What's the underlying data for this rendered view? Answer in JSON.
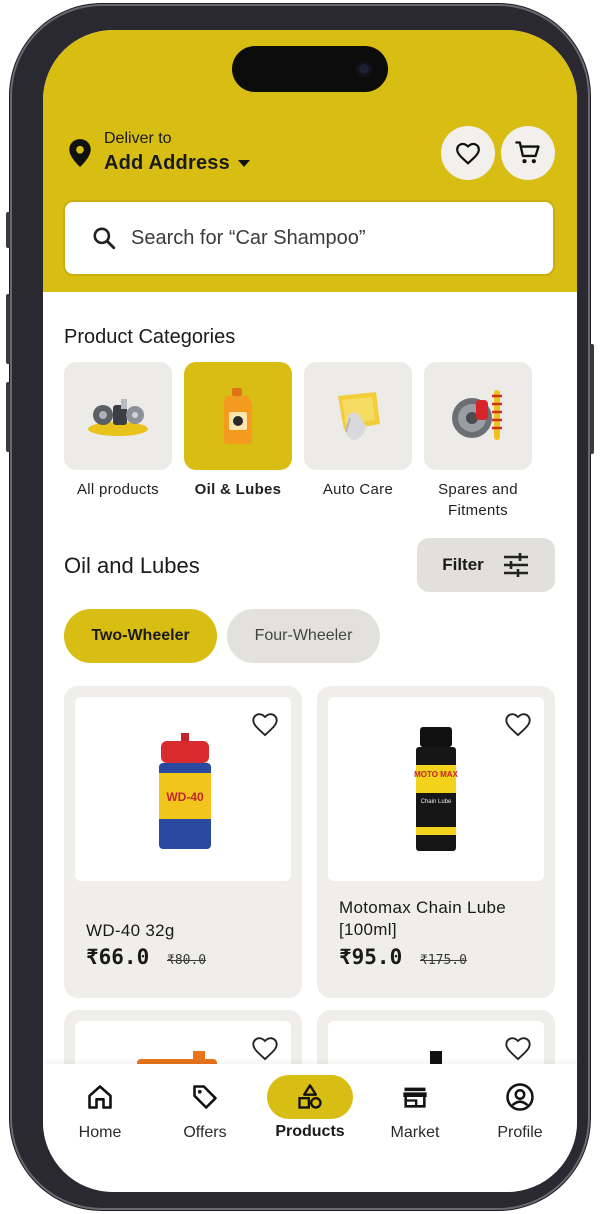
{
  "header": {
    "deliver_label": "Deliver to",
    "address": "Add Address"
  },
  "search": {
    "placeholder": "Search for “Car Shampoo”"
  },
  "categories": {
    "title": "Product Categories",
    "items": [
      {
        "label": "All products",
        "active": false
      },
      {
        "label": "Oil & Lubes",
        "active": true
      },
      {
        "label": "Auto Care",
        "active": false
      },
      {
        "label": "Spares and Fitments",
        "active": false
      }
    ]
  },
  "listing": {
    "title": "Oil and Lubes",
    "filter_label": "Filter",
    "pills": [
      {
        "label": "Two-Wheeler",
        "active": true
      },
      {
        "label": "Four-Wheeler",
        "active": false
      }
    ]
  },
  "products": [
    {
      "name": "WD-40 32g",
      "price": "₹66.0",
      "old_price": "₹80.0",
      "label_text": "WD-40"
    },
    {
      "name": "Motomax Chain Lube [100ml]",
      "price": "₹95.0",
      "old_price": "₹175.0",
      "label_text": "MOTO MAX",
      "label_sub": "Chain Lube"
    }
  ],
  "nav": {
    "items": [
      {
        "label": "Home",
        "active": false
      },
      {
        "label": "Offers",
        "active": false
      },
      {
        "label": "Products",
        "active": true
      },
      {
        "label": "Market",
        "active": false
      },
      {
        "label": "Profile",
        "active": false
      }
    ]
  },
  "colors": {
    "accent": "#d8bd13",
    "tile": "#ecebe8",
    "card": "#efeeeb"
  }
}
